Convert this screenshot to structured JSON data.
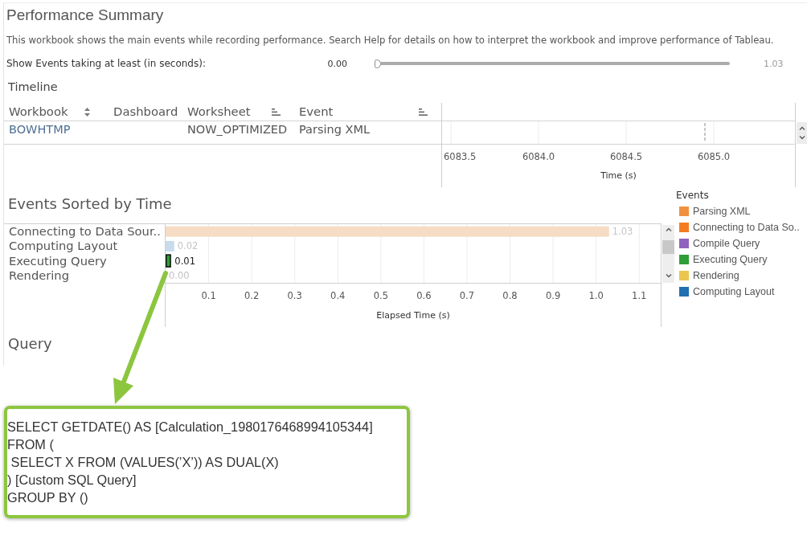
{
  "dashboard": {
    "title": "Performance Summary",
    "description": "This workbook shows the main events while recording performance. Search Help for details on how to interpret the workbook and improve performance of Tableau.",
    "filter": {
      "label": "Show Events taking at least (in seconds):",
      "min_label": "0.00",
      "level": 0,
      "max_label": "1.03"
    }
  },
  "timeline": {
    "title": "Timeline",
    "columns": [
      {
        "label": "Workbook",
        "kind": "alphabetic"
      },
      {
        "label": "Dashboard",
        "kind": "plain"
      },
      {
        "label": "Worksheet",
        "kind": "field"
      },
      {
        "label": "Event",
        "kind": "field"
      }
    ],
    "rows": [
      {
        "workbook": "BOWHTMP",
        "worksheet": "NOW_OPTIMIZED",
        "event": "Parsing XML"
      }
    ],
    "axis": {
      "tick_labels": [
        "6083.5",
        "6084.0",
        "6084.5",
        "6085.0"
      ],
      "title": "Time (s)"
    }
  },
  "events": {
    "title": "Events Sorted by Time",
    "chart_data": {
      "type": "bar",
      "orientation": "horizontal",
      "xlabel": "Elapsed Time (s)",
      "categories": [
        "Connecting to Data Sour..",
        "Computing Layout",
        "Executing Query",
        "Rendering"
      ],
      "values": [
        1.03,
        0.02,
        0.01,
        0
      ],
      "xlim": [
        0,
        1.15
      ],
      "xticks": [
        0.1,
        0.2,
        0.3,
        0.4,
        0.5,
        0.6,
        0.7,
        0.8,
        0.9,
        {
          "value": 1,
          "label": "1.0"
        },
        1.1
      ],
      "grid": true,
      "data_labels": true,
      "value_labels": [
        "1.03",
        "0.02",
        "0.01",
        "0.00"
      ]
    },
    "bars": [
      {
        "color": "#f6dcc4",
        "selected": false
      },
      {
        "color": "#c8dbeb",
        "selected": false
      },
      {
        "color": "#2e9e38",
        "selected": true
      },
      {
        "selected": false
      }
    ]
  },
  "legend": {
    "title": "Events",
    "items": [
      {
        "label": "Parsing XML",
        "color": "#f0913e"
      },
      {
        "label": "Connecting to Data So..",
        "color": "#f47c20"
      },
      {
        "label": "Compile Query",
        "color": "#9162bd"
      },
      {
        "label": "Executing Query",
        "color": "#2e9e38"
      },
      {
        "label": "Rendering",
        "color": "#ebc64f"
      },
      {
        "label": "Computing Layout",
        "color": "#2170b0"
      }
    ]
  },
  "query": {
    "title": "Query",
    "sql_lines": [
      "SELECT GETDATE() AS [Calculation_1980176468994105344]",
      "FROM (",
      " SELECT X FROM (VALUES(’X’)) AS DUAL(X)",
      ") [Custom SQL Query]",
      "GROUP BY ()"
    ]
  }
}
